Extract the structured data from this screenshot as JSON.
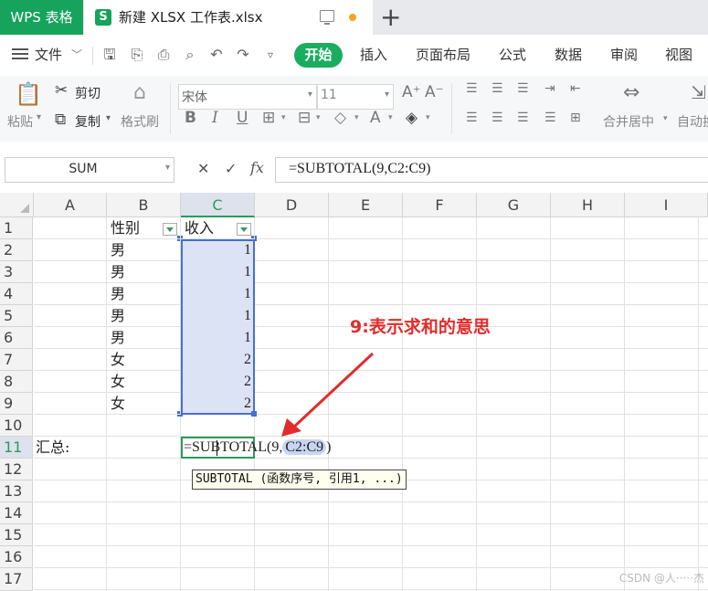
{
  "titlebar": {
    "app_tab": "WPS 表格",
    "doc_icon": "S",
    "doc_title": "新建 XLSX 工作表.xlsx"
  },
  "menu": {
    "file": "文件",
    "start": "开始",
    "items": [
      "插入",
      "页面布局",
      "公式",
      "数据",
      "审阅",
      "视图"
    ]
  },
  "ribbon": {
    "paste": "粘贴",
    "cut": "剪切",
    "copy": "复制",
    "format_painter": "格式刷",
    "font_name": "宋体",
    "font_size": "11",
    "merge": "合并居中",
    "autowrap": "自动换"
  },
  "formula_bar": {
    "name_box": "SUM",
    "formula": "=SUBTOTAL(9,C2:C9)"
  },
  "columns": [
    "A",
    "B",
    "C",
    "D",
    "E",
    "F",
    "G",
    "H",
    "I"
  ],
  "rows": [
    "1",
    "2",
    "3",
    "4",
    "5",
    "6",
    "7",
    "8",
    "9",
    "10",
    "11",
    "12",
    "13",
    "14",
    "15",
    "16",
    "17"
  ],
  "cells": {
    "b1": "性别",
    "c1": "收入",
    "b": [
      "男",
      "男",
      "男",
      "男",
      "男",
      "女",
      "女",
      "女"
    ],
    "c": [
      "1",
      "1",
      "1",
      "1",
      "1",
      "2",
      "2",
      "2"
    ],
    "a11": "汇总:",
    "c11_prefix": "=SUBTOTAL(9,",
    "c11_ref": "C2:C9",
    "c11_suffix": ")"
  },
  "tooltip": "SUBTOTAL (函数序号, 引用1, ...)",
  "annotation": "9:表示求和的意思",
  "watermark": "CSDN @人·····杰",
  "colors": {
    "accent": "#1aad5f",
    "selection": "#dce3f4",
    "annotation": "#e12c2c"
  }
}
